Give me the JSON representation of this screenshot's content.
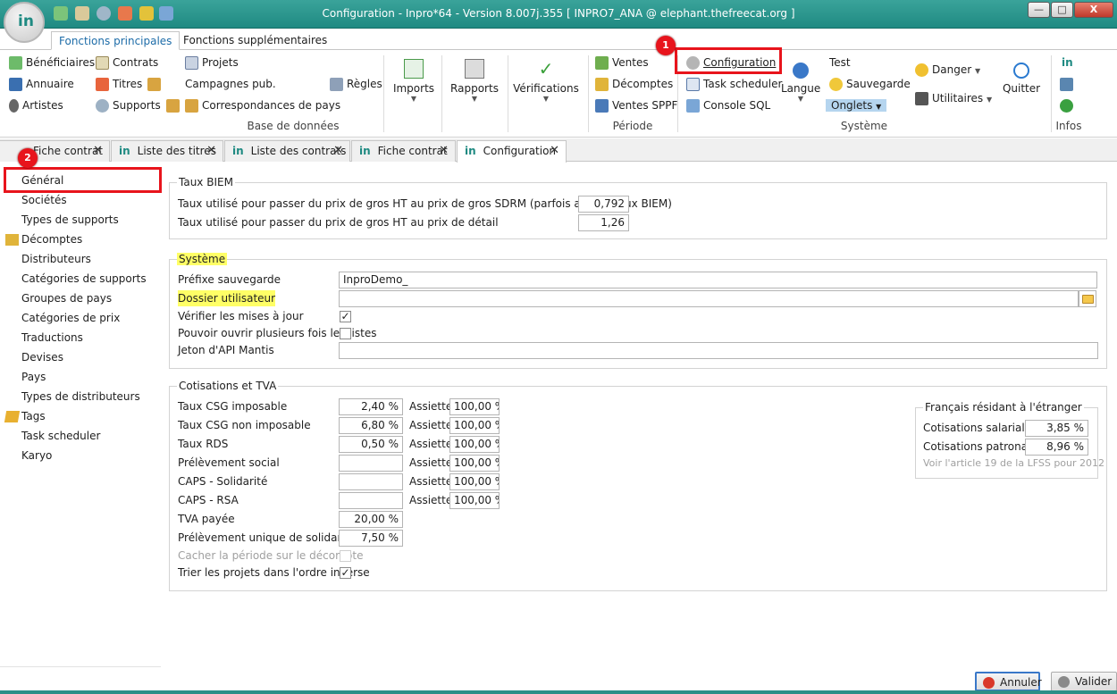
{
  "window": {
    "title": "Configuration - Inpro*64 - Version 8.007j.355  [ INPRO7_ANA @ elephant.thefreecat.org ]",
    "logo_text": "in",
    "minimize": "—",
    "maximize": "□",
    "close": "X"
  },
  "ribbon_tabs": {
    "main": "Fonctions principales",
    "extra": "Fonctions supplémentaires"
  },
  "ribbon": {
    "db_items": {
      "beneficiaires": "Bénéficiaires",
      "annuaire": "Annuaire",
      "artistes": "Artistes",
      "contrats": "Contrats",
      "titres": "Titres",
      "supports": "Supports",
      "projets": "Projets",
      "campagnes": "Campagnes pub.",
      "correspondances": "Correspondances de pays",
      "regles": "Règles"
    },
    "db_label": "Base de données",
    "imports": "Imports",
    "rapports": "Rapports",
    "verifications": "Vérifications",
    "periode_items": {
      "ventes": "Ventes",
      "decomptes": "Décomptes",
      "ventes_sppf": "Ventes SPPF"
    },
    "periode_label": "Période",
    "systeme_items": {
      "configuration": "Configuration",
      "task_scheduler": "Task scheduler",
      "console_sql": "Console SQL",
      "langue": "Langue",
      "test": "Test",
      "sauvegarde": "Sauvegarde",
      "onglets": "Onglets",
      "danger": "Danger",
      "utilitaires": "Utilitaires",
      "quitter": "Quitter"
    },
    "systeme_label": "Système",
    "infos_label": "Infos",
    "infos_in": "in"
  },
  "doc_tabs": [
    {
      "label": "Fiche contrat"
    },
    {
      "label": "Liste des titres"
    },
    {
      "label": "Liste des contrats"
    },
    {
      "label": "Fiche contrat"
    },
    {
      "label": "Configuration"
    }
  ],
  "tab_close": "✕",
  "tab_in": "in",
  "sidebar": {
    "items": [
      "Général",
      "Sociétés",
      "Types de supports",
      "Décomptes",
      "Distributeurs",
      "Catégories de supports",
      "Groupes de pays",
      "Catégories de prix",
      "Traductions",
      "Devises",
      "Pays",
      "Types de distributeurs",
      "Tags",
      "Task scheduler",
      "Karyo"
    ]
  },
  "taux_biem": {
    "legend": "Taux BIEM",
    "sdrm_label": "Taux utilisé pour passer du prix de gros HT au prix de gros SDRM (parfois appelé taux BIEM)",
    "sdrm_value": "0,792",
    "detail_label": "Taux utilisé pour passer du prix de gros HT au prix de détail",
    "detail_value": "1,26"
  },
  "systeme": {
    "legend": "Système",
    "prefixe_label": "Préfixe sauvegarde",
    "prefixe_value": "InproDemo_",
    "dossier_label": "Dossier utilisateur",
    "dossier_value": "",
    "verifier_label": "Vérifier les mises à jour",
    "verifier_checked": "✓",
    "ouvrir_label": "Pouvoir ouvrir plusieurs fois les listes",
    "ouvrir_checked": "",
    "jeton_label": "Jeton d'API Mantis",
    "jeton_value": ""
  },
  "cotisations": {
    "legend": "Cotisations et TVA",
    "assiette_label": "Assiette",
    "rows": [
      {
        "label": "Taux CSG imposable",
        "value": "2,40 %",
        "assiette": "100,00 %"
      },
      {
        "label": "Taux CSG non imposable",
        "value": "6,80 %",
        "assiette": "100,00 %"
      },
      {
        "label": "Taux RDS",
        "value": "0,50 %",
        "assiette": "100,00 %"
      },
      {
        "label": "Prélèvement social",
        "value": "",
        "assiette": "100,00 %"
      },
      {
        "label": "CAPS - Solidarité",
        "value": "",
        "assiette": "100,00 %"
      },
      {
        "label": "CAPS - RSA",
        "value": "",
        "assiette": "100,00 %"
      }
    ],
    "tva_label": "TVA payée",
    "tva_value": "20,00 %",
    "prelevement_label": "Prélèvement unique de solidarité",
    "prelevement_value": "7,50 %",
    "cacher_label": "Cacher la période sur le décompte",
    "trier_label": "Trier les projets dans l'ordre inverse",
    "trier_checked": "✓"
  },
  "francais": {
    "legend": "Français résidant à l'étranger",
    "salariales_label": "Cotisations salariales",
    "salariales_value": "3,85 %",
    "patronales_label": "Cotisations patronales",
    "patronales_value": "8,96 %",
    "note": "Voir l'article 19 de la LFSS pour 2012"
  },
  "buttons": {
    "annuler": "Annuler",
    "valider": "Valider"
  },
  "annotations": {
    "badge1": "1",
    "badge2": "2"
  },
  "colors": {
    "titlebar": "#1f8a82",
    "highlight": "#ffff66",
    "annotation_red": "#e8141c"
  }
}
